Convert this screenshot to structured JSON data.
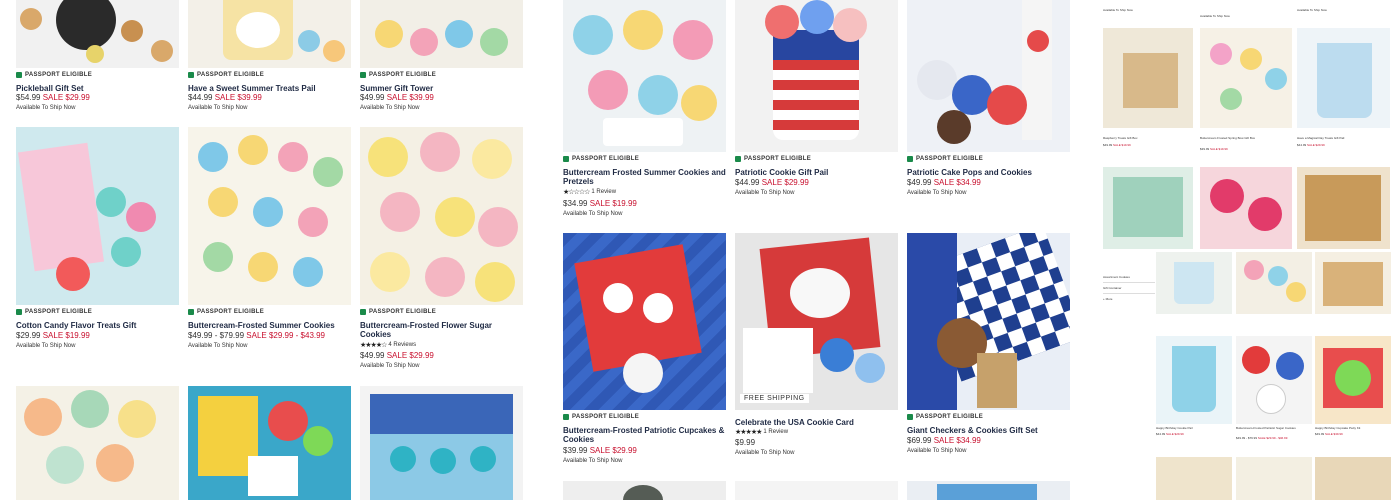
{
  "badge_label": "PASSPORT ELIGIBLE",
  "col1": [
    {
      "title": "Pickleball Gift Set",
      "orig": "$54.99",
      "sale": "SALE $29.99",
      "ship": "Available To Ship Now"
    },
    {
      "title": "Cotton Candy Flavor Treats Gift",
      "orig": "$29.99",
      "sale": "SALE $19.99",
      "ship": "Available To Ship Now"
    }
  ],
  "col2": [
    {
      "title": "Have a Sweet Summer Treats Pail",
      "orig": "$44.99",
      "sale": "SALE $39.99",
      "ship": "Available To Ship Now"
    },
    {
      "title": "Buttercream-Frosted Summer Cookies",
      "orig": "$49.99 - $79.99",
      "sale": "SALE $29.99 - $43.99",
      "ship": "Available To Ship Now"
    }
  ],
  "col3": [
    {
      "title": "Summer Gift Tower",
      "orig": "$49.99",
      "sale": "SALE $39.99",
      "ship": "Available To Ship Now"
    },
    {
      "title": "Buttercream-Frosted Flower Sugar Cookies",
      "reviews": "4 Reviews",
      "orig": "$49.99",
      "sale": "SALE $29.99",
      "ship": "Available To Ship Now"
    }
  ],
  "col4": [
    {
      "title": "Buttercream Frosted Summer Cookies and Pretzels",
      "reviews": "1 Review",
      "orig": "$34.99",
      "sale": "SALE $19.99",
      "ship": "Available To Ship Now"
    },
    {
      "title": "Buttercream-Frosted Patriotic Cupcakes & Cookies",
      "orig": "$39.99",
      "sale": "SALE $29.99",
      "ship": "Available To Ship Now"
    }
  ],
  "col5": [
    {
      "title": "Patriotic Cookie Gift Pail",
      "orig": "$44.99",
      "sale": "SALE $29.99",
      "ship": "Available To Ship Now"
    },
    {
      "title": "Celebrate the USA Cookie Card",
      "reviews": "1 Review",
      "price": "$9.99",
      "ship": "Available To Ship Now",
      "free": "FREE SHIPPING"
    }
  ],
  "col6": [
    {
      "title": "Patriotic Cake Pops and Cookies",
      "orig": "$49.99",
      "sale": "SALE $34.99",
      "ship": "Available To Ship Now"
    },
    {
      "title": "Giant Checkers & Cookies Gift Set",
      "orig": "$69.99",
      "sale": "SALE $34.99",
      "ship": "Available To Ship Now"
    }
  ],
  "mini_row1": [
    {
      "title": "Raspberry Treats Gift Box",
      "orig": "$49.99",
      "sale": "SALE $19.99",
      "ship": "Available To Ship Now"
    },
    {
      "title": "Buttercream Frosted Spring Bow Gift Box",
      "orig": "$39.99",
      "sale": "SALE $19.99",
      "ship": "Available To Ship Now"
    },
    {
      "title": "Have a Magical Day Treats Gift Pail",
      "orig": "$44.99",
      "sale": "SALE $29.99",
      "ship": "Available To Ship Now"
    }
  ],
  "mini_row2": [
    {
      "title": "Happy Birthday Cookie Pail",
      "orig": "$44.99",
      "sale": "SALE $29.99",
      "ship": "Available To Ship Now"
    },
    {
      "title": "Buttercream-Frosted Patriotic Sugar Cookies",
      "orig": "$49.99 - $79.99",
      "sale": "SALE $29.99 - $46.99",
      "ship": "Available To Ship Now"
    },
    {
      "title": "Happy Birthday Cupcake Party Kit",
      "orig": "$49.99",
      "sale": "SALE $39.99",
      "ship": "Available To Ship Now"
    }
  ],
  "mini_row0": [
    {
      "title": "Available To Ship Now"
    },
    {
      "title": "Available To Ship Now"
    },
    {
      "title": "Available To Ship Now"
    }
  ],
  "filters": [
    "Assortment Cookies",
    "Gift Container",
    "+ More"
  ],
  "colors": {
    "title": "#1f2a44",
    "sale": "#c8102e",
    "badge": "#1a8a4a"
  }
}
